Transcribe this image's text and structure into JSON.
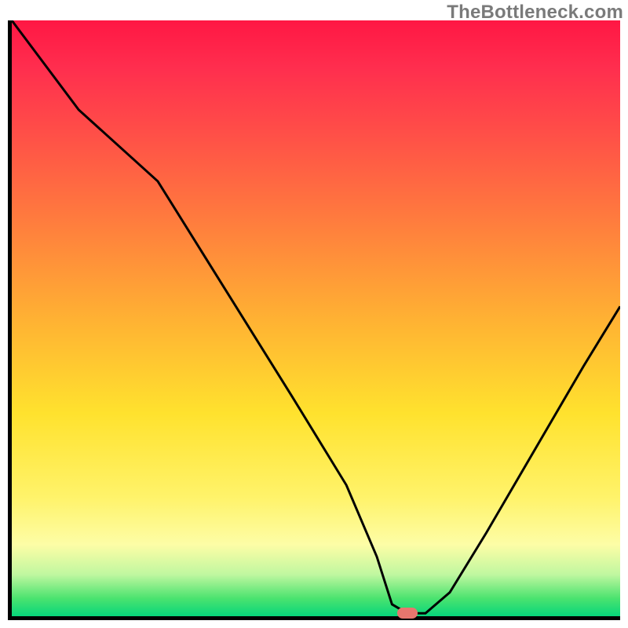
{
  "watermark": {
    "text": "TheBottleneck.com"
  },
  "chart_data": {
    "type": "line",
    "title": "",
    "xlabel": "",
    "ylabel": "",
    "xlim": [
      0,
      100
    ],
    "ylim": [
      0,
      100
    ],
    "x": [
      0,
      11,
      24,
      35,
      46,
      55,
      60,
      62.5,
      65,
      68,
      72,
      78,
      86,
      94,
      100
    ],
    "values": [
      100,
      85,
      73,
      55,
      37,
      22,
      10,
      2,
      0.5,
      0.5,
      4,
      14,
      28,
      42,
      52
    ],
    "optimum_marker": {
      "x": 65,
      "y": 0.5
    },
    "background_gradient": {
      "stops": [
        {
          "pos": 0,
          "color": "#ff1744"
        },
        {
          "pos": 8,
          "color": "#ff2e4e"
        },
        {
          "pos": 20,
          "color": "#ff5247"
        },
        {
          "pos": 33,
          "color": "#ff7a3e"
        },
        {
          "pos": 50,
          "color": "#ffb133"
        },
        {
          "pos": 66,
          "color": "#ffe22e"
        },
        {
          "pos": 80,
          "color": "#fff36a"
        },
        {
          "pos": 88,
          "color": "#fdfda6"
        },
        {
          "pos": 93,
          "color": "#c0f7a0"
        },
        {
          "pos": 97,
          "color": "#4be36f"
        },
        {
          "pos": 100,
          "color": "#06d67b"
        }
      ]
    }
  },
  "colors": {
    "curve": "#000000",
    "marker": "#e8766e",
    "axis": "#000000",
    "watermark": "#7a7a7a"
  }
}
